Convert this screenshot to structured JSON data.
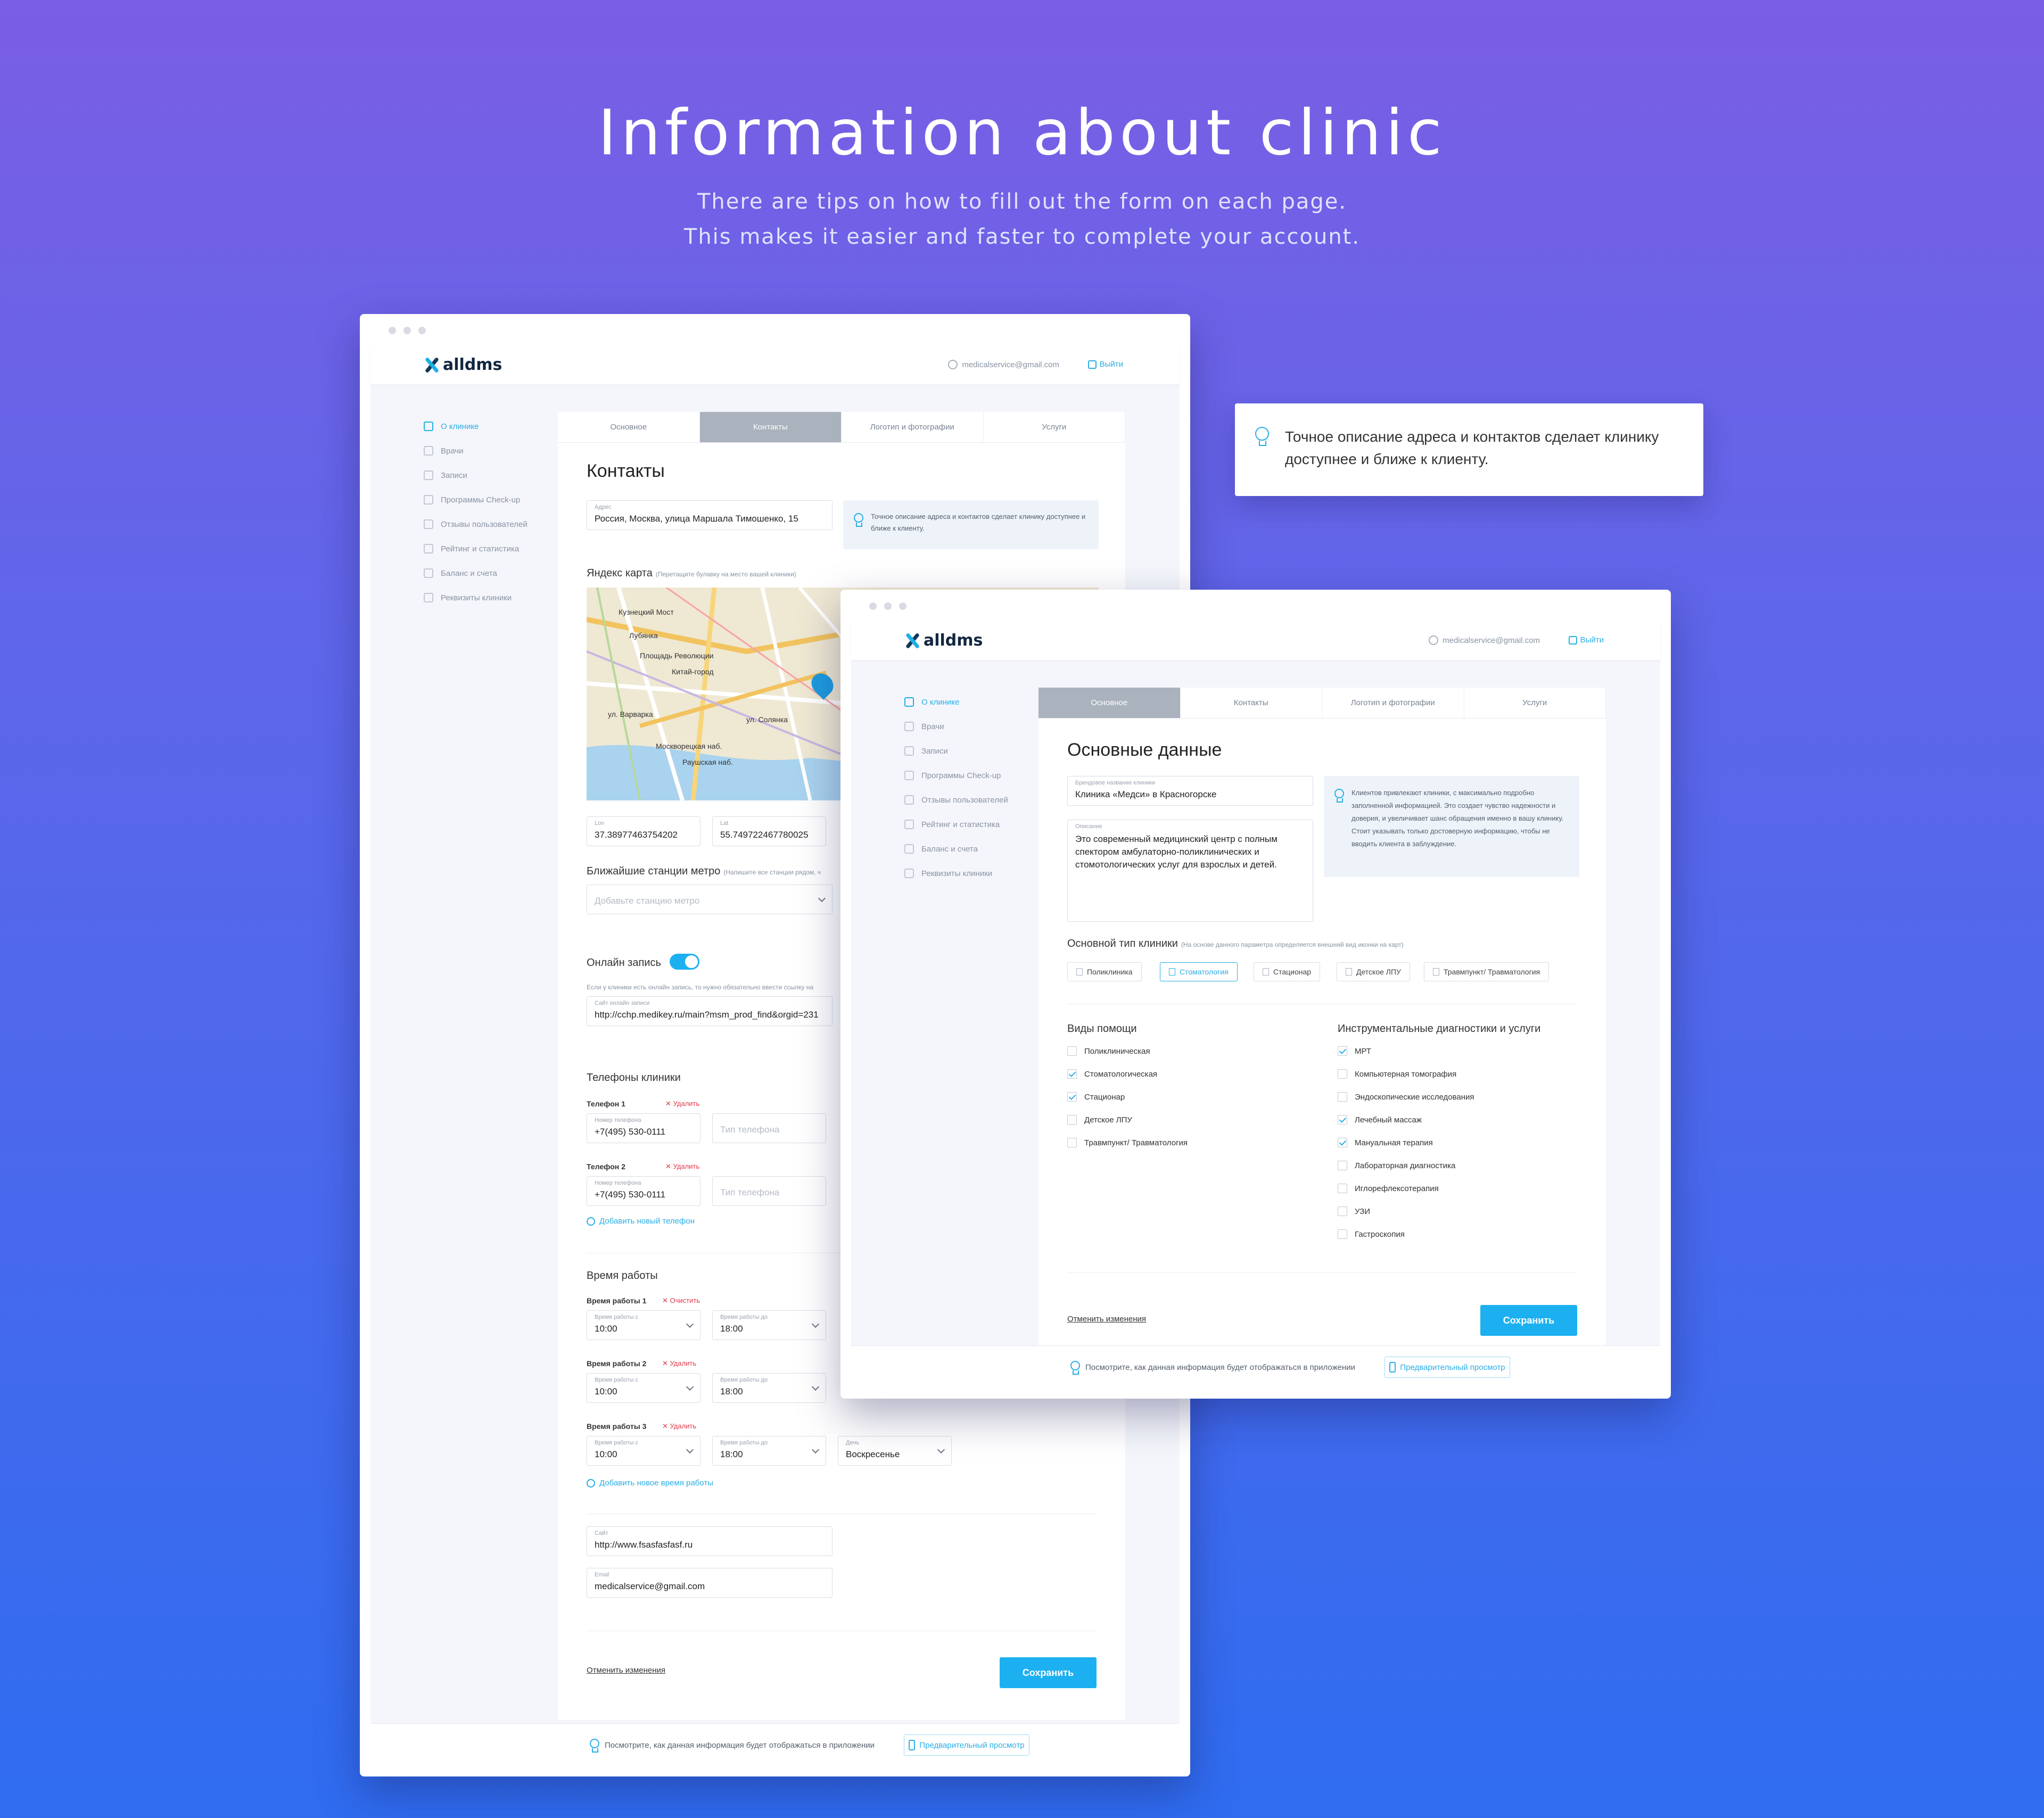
{
  "hero": {
    "title": "Information about clinic",
    "subtitle_line1": "There are tips on how to fill out the form on each page.",
    "subtitle_line2": "This makes it easier and faster to complete your account."
  },
  "callout": {
    "text": "Точное описание адреса и контактов сделает клинику доступнее и ближе к клиенту."
  },
  "app": {
    "logo": "alldms",
    "user_email": "medicalservice@gmail.com",
    "logout": "Выйти",
    "sidebar": [
      "О клинике",
      "Врачи",
      "Записи",
      "Программы Check-up",
      "Отзывы пользователей",
      "Рейтинг и статистика",
      "Баланс и счета",
      "Реквизиты клиники"
    ],
    "tabs": [
      "Основное",
      "Контакты",
      "Логотип и фотографии",
      "Услуги"
    ],
    "undo": "Отменить изменения",
    "save": "Сохранить",
    "footer_hint": "Посмотрите, как данная информация будет отображаться в приложении",
    "preview": "Предварительный просмотр"
  },
  "contacts": {
    "heading": "Контакты",
    "address_label": "Адрес",
    "address_value": "Россия, Москва, улица Маршала Тимошенко, 15",
    "tip": "Точное описание адреса и контактов сделает клинику доступнее и ближе к клиенту.",
    "map_title": "Яндекс карта",
    "map_hint": "(Перетащите булавку на место вашей клиники)",
    "map_labels": [
      "Кузнецкий Мост",
      "Лубянка",
      "Площадь Революции",
      "Китай-город",
      "ул. Варварка",
      "Москворецкая наб.",
      "Раушская наб.",
      "ул. Солянка"
    ],
    "lon_label": "Lon",
    "lon_value": "37.38977463754202",
    "lat_label": "Lat",
    "lat_value": "55.749722467780025",
    "metro_title": "Ближайшие станции метро",
    "metro_hint": "(Напишите все станции рядом, ч",
    "metro_placeholder": "Добавьте станцию метро",
    "online_title": "Онлайн запись",
    "online_hint": "Если у клиники есть онлайн запись, то нужно обязательно ввести ссылку на",
    "online_site_label": "Сайт онлайн записи",
    "online_site_value": "http://cchp.medikey.ru/main?msm_prod_find&orgid=231",
    "phones_title": "Телефоны клиники",
    "phone1_label": "Телефон 1",
    "phone2_label": "Телефон 2",
    "delete": "✕ Удалить",
    "clear": "✕ Очистить",
    "phone_field_label": "Номер телефона",
    "phone1_value": "+7(495) 530-0111",
    "phone2_value": "+7(495) 530-0111",
    "phone_type_placeholder": "Тип телефона",
    "add_phone": "Добавить новый телефон",
    "hours_title": "Время работы",
    "hours1_label": "Время работы 1",
    "hours2_label": "Время работы 2",
    "hours3_label": "Время работы 3",
    "from_label": "Время работы с",
    "to_label": "Время работы до",
    "from_value": "10:00",
    "to_value": "18:00",
    "day_label": "День",
    "day_value": "Воскресенье",
    "add_hours": "Добавить новое время работы",
    "site_label": "Сайт",
    "site_value": "http://www.fsasfasfasf.ru",
    "email_label": "Email",
    "email_value": "medicalservice@gmail.com"
  },
  "basic": {
    "heading": "Основные данные",
    "brand_label": "Брендовое название клиники",
    "brand_value": "Клиника «Медси» в Красногорске",
    "desc_label": "Описание",
    "desc_value": "Это современный медицинский центр с полным спектором амбулаторно-поликлинических и стомотологических услуг для взрослых и детей.",
    "tip": "Клиентов привлекают клиники, с максимально подробно заполненной информацией. Это создает чувство надежности и доверия, и увеличивает шанс обращения именно в вашу клинику. Стоит указывать только достоверную информацию, чтобы не вводить клиента в заблуждение.",
    "type_title": "Основной тип клиники",
    "type_hint": "(На основе данного параметра определяется внешний вид иконки на карт)",
    "types": [
      "Поликлиника",
      "Стоматология",
      "Стационар",
      "Детское ЛПУ",
      "Травмпункт/ Травматология"
    ],
    "help_title": "Виды помощи",
    "help": [
      {
        "label": "Поликлиническая",
        "checked": false
      },
      {
        "label": "Стоматологическая",
        "checked": true
      },
      {
        "label": "Стационар",
        "checked": true
      },
      {
        "label": "Детское ЛПУ",
        "checked": false
      },
      {
        "label": "Травмпункт/ Травматология",
        "checked": false
      }
    ],
    "diag_title": "Инструментальные диагностики и услуги",
    "diag": [
      {
        "label": "МРТ",
        "checked": true
      },
      {
        "label": "Компьютерная томография",
        "checked": false
      },
      {
        "label": "Эндоскопические исследования",
        "checked": false
      },
      {
        "label": "Лечебный массаж",
        "checked": true
      },
      {
        "label": "Мануальная терапия",
        "checked": true
      },
      {
        "label": "Лабораторная диагностика",
        "checked": false
      },
      {
        "label": "Иглорефлексотерапия",
        "checked": false
      },
      {
        "label": "УЗИ",
        "checked": false
      },
      {
        "label": "Гастроскопия",
        "checked": false
      }
    ]
  }
}
